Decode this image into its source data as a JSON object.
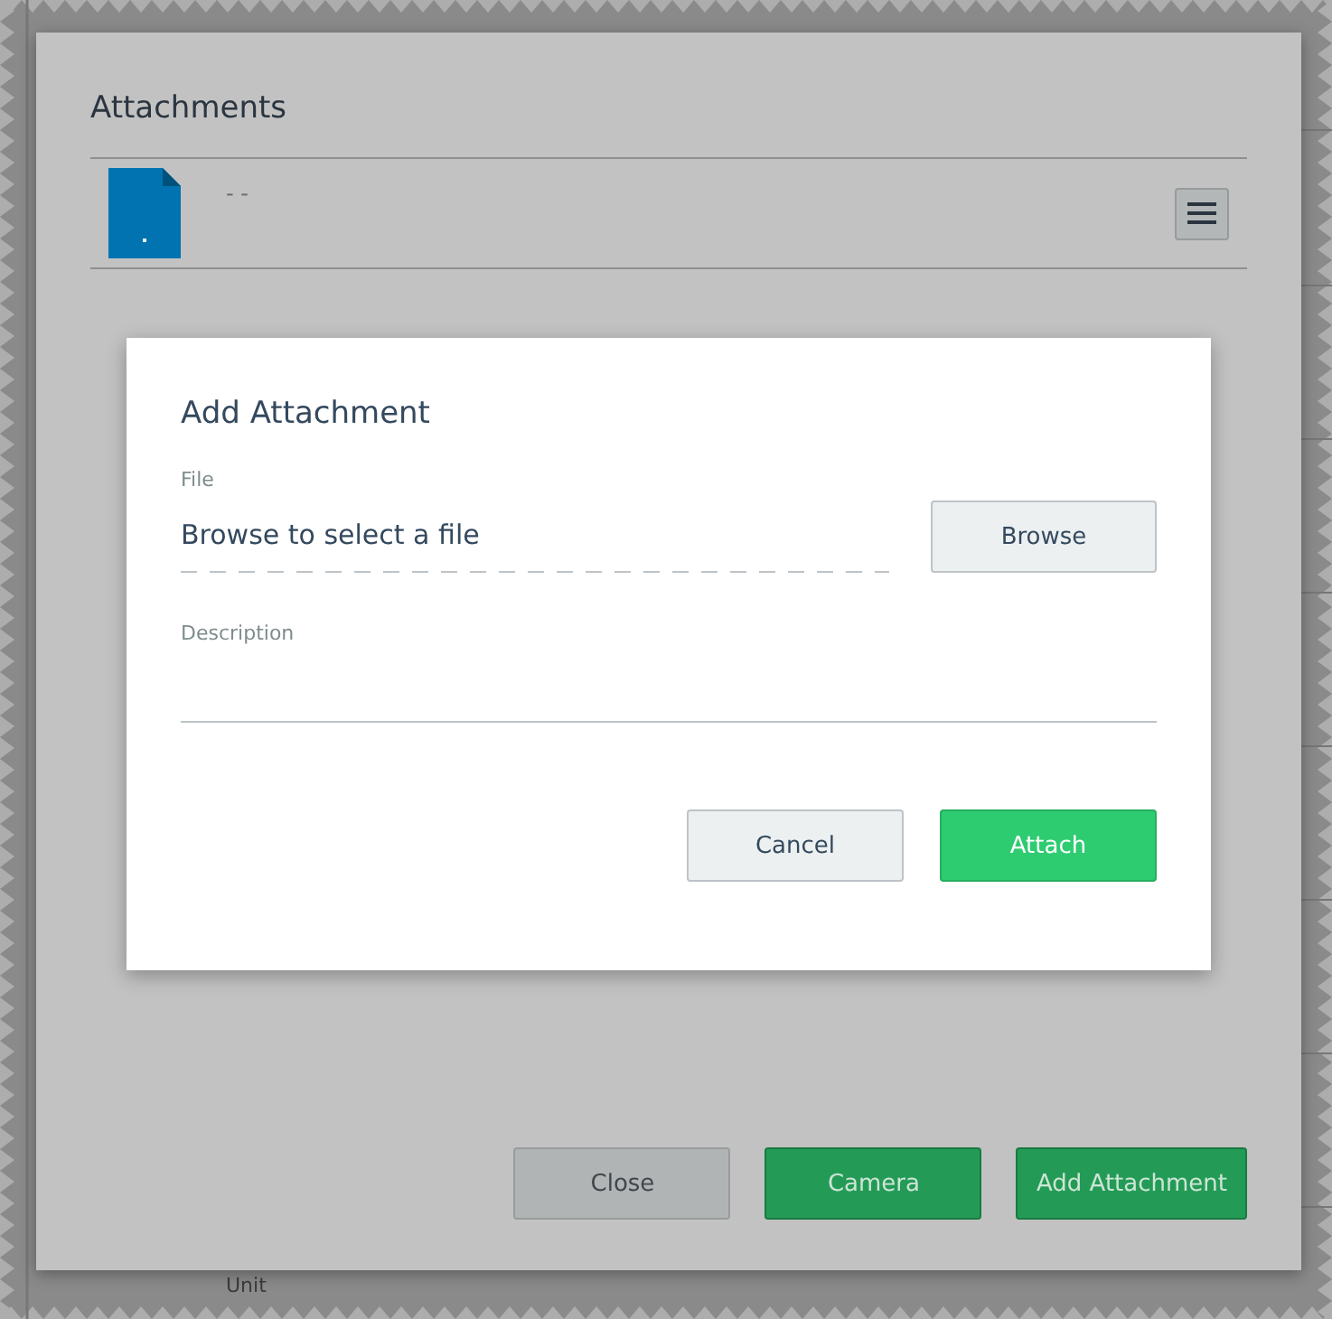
{
  "background_page": {
    "row_label": "Unit"
  },
  "attachments_dialog": {
    "title": "Attachments",
    "attachments": [
      {
        "caption": "- -"
      }
    ],
    "buttons": [
      {
        "label": "Close",
        "kind": "secondary"
      },
      {
        "label": "Camera",
        "kind": "primary"
      },
      {
        "label": "Add Attachment",
        "kind": "primary"
      }
    ]
  },
  "add_attachment_dialog": {
    "title": "Add Attachment",
    "file": {
      "label": "File",
      "value": "Browse to select a file",
      "button": "Browse"
    },
    "description": {
      "label": "Description"
    },
    "buttons": [
      {
        "label": "Cancel",
        "kind": "secondary"
      },
      {
        "label": "Attach",
        "kind": "primary"
      }
    ]
  }
}
